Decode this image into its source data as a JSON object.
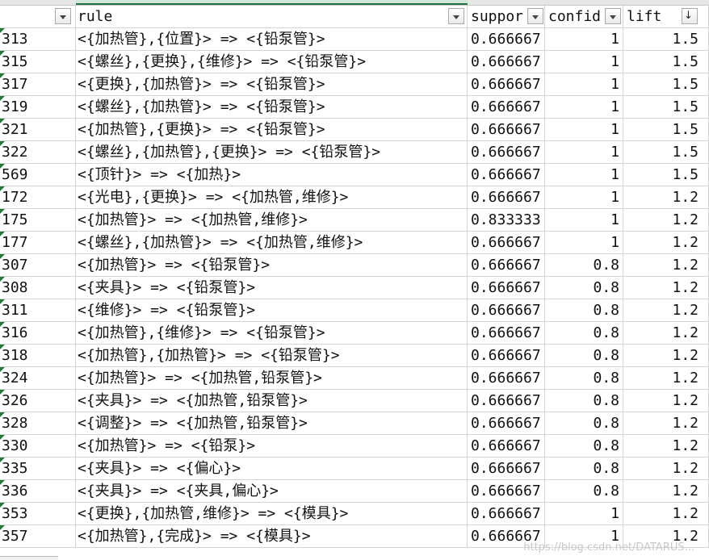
{
  "header": {
    "col_a": "",
    "col_b": "rule",
    "col_c": "suppor",
    "col_d": "confid",
    "col_e": "lift"
  },
  "rows": [
    {
      "id": "313",
      "rule": "<{加热管},{位置}> => <{铅泵管}>",
      "support": "0.666667",
      "confidence": "1",
      "lift": "1.5"
    },
    {
      "id": "315",
      "rule": "<{螺丝},{更换},{维修}> => <{铅泵管}>",
      "support": "0.666667",
      "confidence": "1",
      "lift": "1.5"
    },
    {
      "id": "317",
      "rule": "<{更换},{加热管}> => <{铅泵管}>",
      "support": "0.666667",
      "confidence": "1",
      "lift": "1.5"
    },
    {
      "id": "319",
      "rule": "<{螺丝},{加热管}> => <{铅泵管}>",
      "support": "0.666667",
      "confidence": "1",
      "lift": "1.5"
    },
    {
      "id": "321",
      "rule": "<{加热管},{更换}> => <{铅泵管}>",
      "support": "0.666667",
      "confidence": "1",
      "lift": "1.5"
    },
    {
      "id": "322",
      "rule": "<{螺丝},{加热管},{更换}> => <{铅泵管}>",
      "support": "0.666667",
      "confidence": "1",
      "lift": "1.5"
    },
    {
      "id": "569",
      "rule": "<{顶针}> => <{加热}>",
      "support": "0.666667",
      "confidence": "1",
      "lift": "1.5"
    },
    {
      "id": "172",
      "rule": "<{光电},{更换}> => <{加热管,维修}>",
      "support": "0.666667",
      "confidence": "1",
      "lift": "1.2"
    },
    {
      "id": "175",
      "rule": "<{加热管}> => <{加热管,维修}>",
      "support": "0.833333",
      "confidence": "1",
      "lift": "1.2"
    },
    {
      "id": "177",
      "rule": "<{螺丝},{加热管}> => <{加热管,维修}>",
      "support": "0.666667",
      "confidence": "1",
      "lift": "1.2"
    },
    {
      "id": "307",
      "rule": "<{加热管}> => <{铅泵管}>",
      "support": "0.666667",
      "confidence": "0.8",
      "lift": "1.2"
    },
    {
      "id": "308",
      "rule": "<{夹具}> => <{铅泵管}>",
      "support": "0.666667",
      "confidence": "0.8",
      "lift": "1.2"
    },
    {
      "id": "311",
      "rule": "<{维修}> => <{铅泵管}>",
      "support": "0.666667",
      "confidence": "0.8",
      "lift": "1.2"
    },
    {
      "id": "316",
      "rule": "<{加热管},{维修}> => <{铅泵管}>",
      "support": "0.666667",
      "confidence": "0.8",
      "lift": "1.2"
    },
    {
      "id": "318",
      "rule": "<{加热管},{加热管}> => <{铅泵管}>",
      "support": "0.666667",
      "confidence": "0.8",
      "lift": "1.2"
    },
    {
      "id": "324",
      "rule": "<{加热管}> => <{加热管,铅泵管}>",
      "support": "0.666667",
      "confidence": "0.8",
      "lift": "1.2"
    },
    {
      "id": "326",
      "rule": "<{夹具}> => <{加热管,铅泵管}>",
      "support": "0.666667",
      "confidence": "0.8",
      "lift": "1.2"
    },
    {
      "id": "328",
      "rule": "<{调整}> => <{加热管,铅泵管}>",
      "support": "0.666667",
      "confidence": "0.8",
      "lift": "1.2"
    },
    {
      "id": "330",
      "rule": "<{加热管}> => <{铅泵}>",
      "support": "0.666667",
      "confidence": "0.8",
      "lift": "1.2"
    },
    {
      "id": "335",
      "rule": "<{夹具}> => <{偏心}>",
      "support": "0.666667",
      "confidence": "0.8",
      "lift": "1.2"
    },
    {
      "id": "336",
      "rule": "<{夹具}> => <{夹具,偏心}>",
      "support": "0.666667",
      "confidence": "0.8",
      "lift": "1.2"
    },
    {
      "id": "353",
      "rule": "<{更换},{加热管,维修}> => <{模具}>",
      "support": "0.666667",
      "confidence": "1",
      "lift": "1.2"
    },
    {
      "id": "357",
      "rule": "<{加热管},{完成}> => <{模具}>",
      "support": "0.666667",
      "confidence": "1",
      "lift": "1.2"
    }
  ],
  "watermark": "https://blog.csdn.net/DATARUS..."
}
